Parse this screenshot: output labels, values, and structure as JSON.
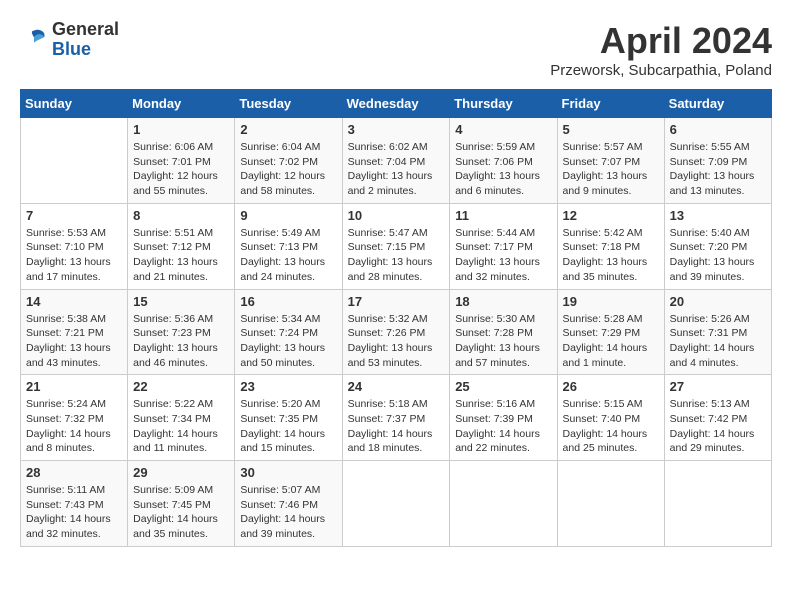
{
  "header": {
    "logo": {
      "line1": "General",
      "line2": "Blue"
    },
    "title": "April 2024",
    "subtitle": "Przeworsk, Subcarpathia, Poland"
  },
  "days_of_week": [
    "Sunday",
    "Monday",
    "Tuesday",
    "Wednesday",
    "Thursday",
    "Friday",
    "Saturday"
  ],
  "weeks": [
    [
      {
        "day": "",
        "info": ""
      },
      {
        "day": "1",
        "info": "Sunrise: 6:06 AM\nSunset: 7:01 PM\nDaylight: 12 hours\nand 55 minutes."
      },
      {
        "day": "2",
        "info": "Sunrise: 6:04 AM\nSunset: 7:02 PM\nDaylight: 12 hours\nand 58 minutes."
      },
      {
        "day": "3",
        "info": "Sunrise: 6:02 AM\nSunset: 7:04 PM\nDaylight: 13 hours\nand 2 minutes."
      },
      {
        "day": "4",
        "info": "Sunrise: 5:59 AM\nSunset: 7:06 PM\nDaylight: 13 hours\nand 6 minutes."
      },
      {
        "day": "5",
        "info": "Sunrise: 5:57 AM\nSunset: 7:07 PM\nDaylight: 13 hours\nand 9 minutes."
      },
      {
        "day": "6",
        "info": "Sunrise: 5:55 AM\nSunset: 7:09 PM\nDaylight: 13 hours\nand 13 minutes."
      }
    ],
    [
      {
        "day": "7",
        "info": "Sunrise: 5:53 AM\nSunset: 7:10 PM\nDaylight: 13 hours\nand 17 minutes."
      },
      {
        "day": "8",
        "info": "Sunrise: 5:51 AM\nSunset: 7:12 PM\nDaylight: 13 hours\nand 21 minutes."
      },
      {
        "day": "9",
        "info": "Sunrise: 5:49 AM\nSunset: 7:13 PM\nDaylight: 13 hours\nand 24 minutes."
      },
      {
        "day": "10",
        "info": "Sunrise: 5:47 AM\nSunset: 7:15 PM\nDaylight: 13 hours\nand 28 minutes."
      },
      {
        "day": "11",
        "info": "Sunrise: 5:44 AM\nSunset: 7:17 PM\nDaylight: 13 hours\nand 32 minutes."
      },
      {
        "day": "12",
        "info": "Sunrise: 5:42 AM\nSunset: 7:18 PM\nDaylight: 13 hours\nand 35 minutes."
      },
      {
        "day": "13",
        "info": "Sunrise: 5:40 AM\nSunset: 7:20 PM\nDaylight: 13 hours\nand 39 minutes."
      }
    ],
    [
      {
        "day": "14",
        "info": "Sunrise: 5:38 AM\nSunset: 7:21 PM\nDaylight: 13 hours\nand 43 minutes."
      },
      {
        "day": "15",
        "info": "Sunrise: 5:36 AM\nSunset: 7:23 PM\nDaylight: 13 hours\nand 46 minutes."
      },
      {
        "day": "16",
        "info": "Sunrise: 5:34 AM\nSunset: 7:24 PM\nDaylight: 13 hours\nand 50 minutes."
      },
      {
        "day": "17",
        "info": "Sunrise: 5:32 AM\nSunset: 7:26 PM\nDaylight: 13 hours\nand 53 minutes."
      },
      {
        "day": "18",
        "info": "Sunrise: 5:30 AM\nSunset: 7:28 PM\nDaylight: 13 hours\nand 57 minutes."
      },
      {
        "day": "19",
        "info": "Sunrise: 5:28 AM\nSunset: 7:29 PM\nDaylight: 14 hours\nand 1 minute."
      },
      {
        "day": "20",
        "info": "Sunrise: 5:26 AM\nSunset: 7:31 PM\nDaylight: 14 hours\nand 4 minutes."
      }
    ],
    [
      {
        "day": "21",
        "info": "Sunrise: 5:24 AM\nSunset: 7:32 PM\nDaylight: 14 hours\nand 8 minutes."
      },
      {
        "day": "22",
        "info": "Sunrise: 5:22 AM\nSunset: 7:34 PM\nDaylight: 14 hours\nand 11 minutes."
      },
      {
        "day": "23",
        "info": "Sunrise: 5:20 AM\nSunset: 7:35 PM\nDaylight: 14 hours\nand 15 minutes."
      },
      {
        "day": "24",
        "info": "Sunrise: 5:18 AM\nSunset: 7:37 PM\nDaylight: 14 hours\nand 18 minutes."
      },
      {
        "day": "25",
        "info": "Sunrise: 5:16 AM\nSunset: 7:39 PM\nDaylight: 14 hours\nand 22 minutes."
      },
      {
        "day": "26",
        "info": "Sunrise: 5:15 AM\nSunset: 7:40 PM\nDaylight: 14 hours\nand 25 minutes."
      },
      {
        "day": "27",
        "info": "Sunrise: 5:13 AM\nSunset: 7:42 PM\nDaylight: 14 hours\nand 29 minutes."
      }
    ],
    [
      {
        "day": "28",
        "info": "Sunrise: 5:11 AM\nSunset: 7:43 PM\nDaylight: 14 hours\nand 32 minutes."
      },
      {
        "day": "29",
        "info": "Sunrise: 5:09 AM\nSunset: 7:45 PM\nDaylight: 14 hours\nand 35 minutes."
      },
      {
        "day": "30",
        "info": "Sunrise: 5:07 AM\nSunset: 7:46 PM\nDaylight: 14 hours\nand 39 minutes."
      },
      {
        "day": "",
        "info": ""
      },
      {
        "day": "",
        "info": ""
      },
      {
        "day": "",
        "info": ""
      },
      {
        "day": "",
        "info": ""
      }
    ]
  ]
}
